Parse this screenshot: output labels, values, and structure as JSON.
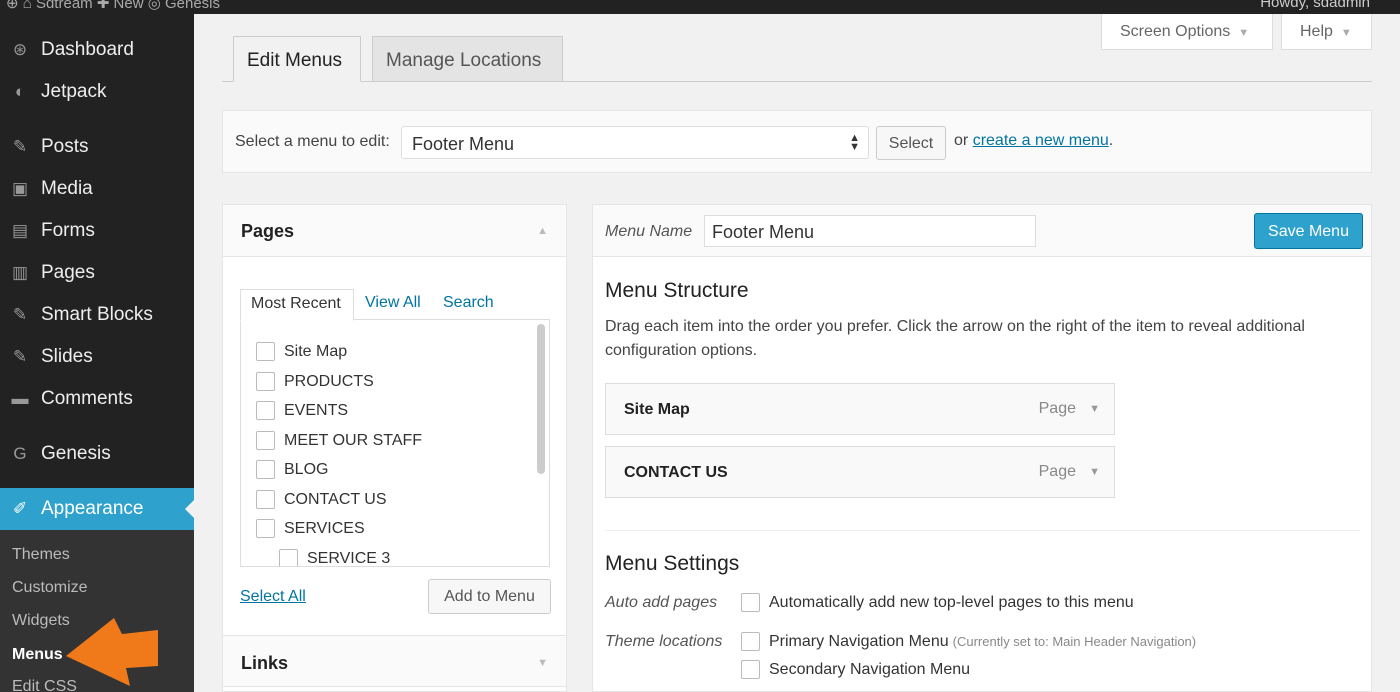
{
  "admin_bar": {
    "left_text": "⊕  ⌂ Sdtream  ✚ New  ◎ Genesis",
    "right_text": "Howdy, sdadmin"
  },
  "sidebar": {
    "items": [
      {
        "label": "Dashboard",
        "icon": "dashboard-icon",
        "glyph": "⊛"
      },
      {
        "label": "Jetpack",
        "icon": "jetpack-icon",
        "glyph": "◐"
      },
      {
        "label": "Posts",
        "icon": "pin-icon",
        "glyph": "✎"
      },
      {
        "label": "Media",
        "icon": "media-icon",
        "glyph": "▣"
      },
      {
        "label": "Forms",
        "icon": "forms-icon",
        "glyph": "▤"
      },
      {
        "label": "Pages",
        "icon": "pages-icon",
        "glyph": "▥"
      },
      {
        "label": "Smart Blocks",
        "icon": "pin-icon",
        "glyph": "✎"
      },
      {
        "label": "Slides",
        "icon": "pin-icon",
        "glyph": "✎"
      },
      {
        "label": "Comments",
        "icon": "comments-icon",
        "glyph": "▬"
      },
      {
        "label": "Genesis",
        "icon": "genesis-icon",
        "glyph": "G"
      },
      {
        "label": "Appearance",
        "icon": "appearance-icon",
        "glyph": "✐"
      }
    ],
    "submenu": [
      {
        "label": "Themes"
      },
      {
        "label": "Customize"
      },
      {
        "label": "Widgets"
      },
      {
        "label": "Menus"
      },
      {
        "label": "Edit CSS"
      }
    ]
  },
  "header": {
    "screen_options": "Screen Options",
    "help": "Help",
    "tabs": [
      {
        "label": "Edit Menus"
      },
      {
        "label": "Manage Locations"
      }
    ]
  },
  "select_bar": {
    "label": "Select a menu to edit:",
    "selected": "Footer Menu",
    "select_button": "Select",
    "or_text": "or",
    "create_link": "create a new menu",
    "period": "."
  },
  "pages_box": {
    "title": "Pages",
    "tabs": [
      "Most Recent",
      "View All",
      "Search"
    ],
    "items": [
      "Site Map",
      "PRODUCTS",
      "EVENTS",
      "MEET OUR STAFF",
      "BLOG",
      "CONTACT US",
      "SERVICES",
      "SERVICE 3"
    ],
    "select_all": "Select All",
    "add_button": "Add to Menu",
    "links_title": "Links"
  },
  "menu_box": {
    "name_label": "Menu Name",
    "name_value": "Footer Menu",
    "save_button": "Save Menu",
    "structure_title": "Menu Structure",
    "structure_desc": "Drag each item into the order you prefer. Click the arrow on the right of the item to reveal additional configuration options.",
    "items": [
      {
        "title": "Site Map",
        "type": "Page"
      },
      {
        "title": "CONTACT US",
        "type": "Page"
      }
    ],
    "settings_title": "Menu Settings",
    "auto_add_label": "Auto add pages",
    "auto_add_option": "Automatically add new top-level pages to this menu",
    "theme_locations_label": "Theme locations",
    "primary_nav": "Primary Navigation Menu",
    "primary_note": "(Currently set to: Main Header Navigation)",
    "secondary_nav": "Secondary Navigation Menu"
  },
  "colors": {
    "accent": "#2ea2cc",
    "link": "#0074a2",
    "sidebar": "#222222",
    "pointer_arrow": "#f07a1a"
  }
}
